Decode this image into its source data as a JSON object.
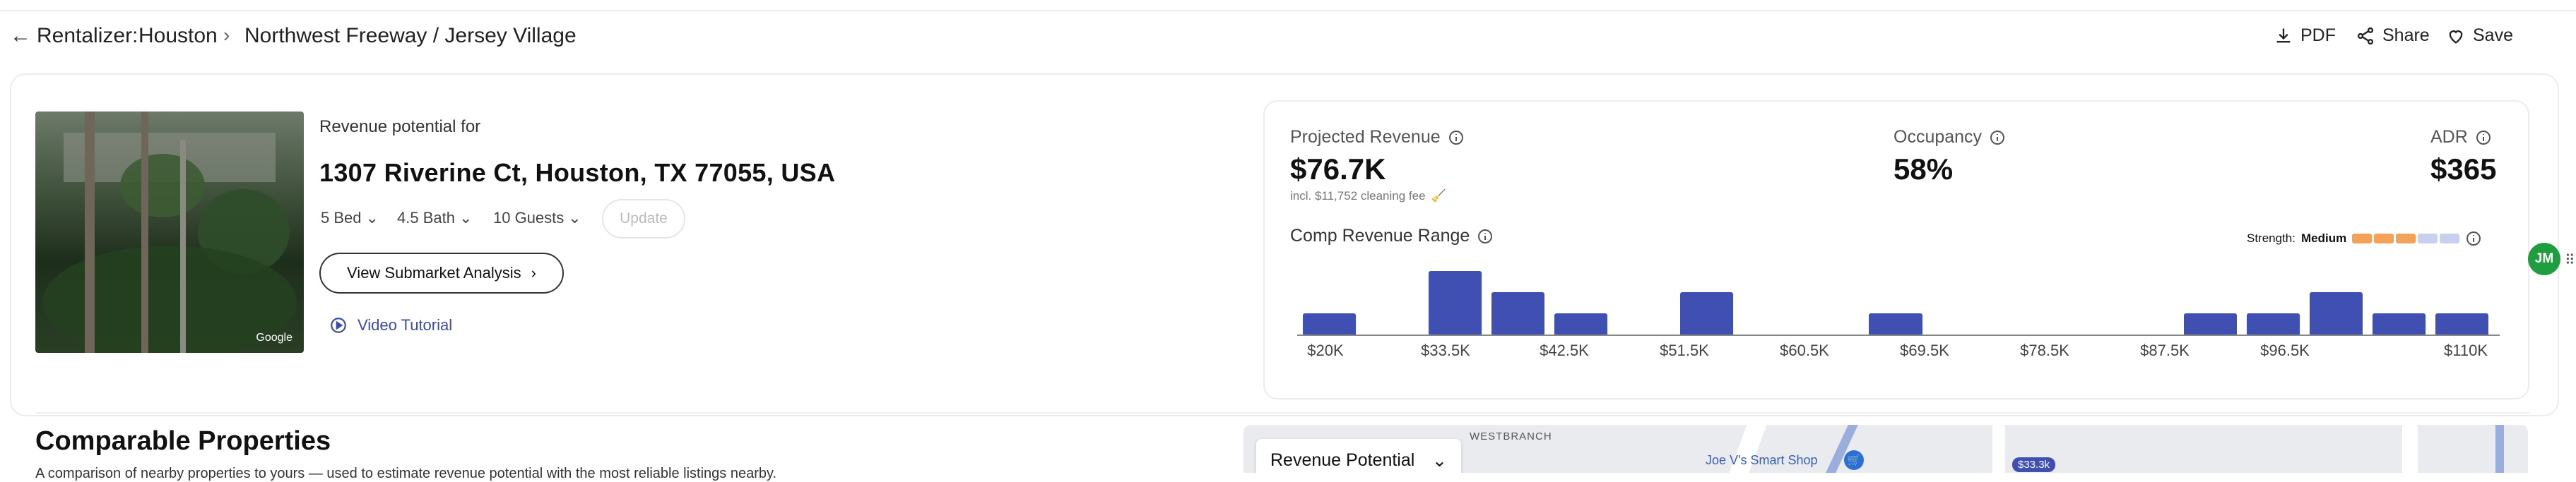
{
  "header": {
    "back_icon": "arrow-left-icon",
    "crumb_root": "Rentalizer:",
    "crumb_city": "Houston",
    "crumb_area": "Northwest Freeway / Jersey Village",
    "actions": {
      "pdf": "PDF",
      "share": "Share",
      "save": "Save"
    }
  },
  "property": {
    "revenue_potential_label": "Revenue potential for",
    "address": "1307 Riverine Ct, Houston, TX 77055, USA",
    "photo_credit": "Google",
    "beds": "5 Bed",
    "baths": "4.5 Bath",
    "guests": "10 Guests",
    "update_label": "Update",
    "submarket_button": "View Submarket Analysis",
    "video_tutorial": "Video Tutorial"
  },
  "metrics": {
    "projected_revenue_label": "Projected Revenue",
    "projected_revenue_value": "$76.7K",
    "cleaning_note": "incl. $11,752 cleaning fee",
    "occupancy_label": "Occupancy",
    "occupancy_value": "58%",
    "adr_label": "ADR",
    "adr_value": "$365",
    "comp_range_label": "Comp Revenue Range",
    "strength_label": "Strength:",
    "strength_value": "Medium",
    "strength_colors": [
      "#f4a259",
      "#f4a259",
      "#f4a259",
      "#c9d0ef",
      "#c9d0ef"
    ]
  },
  "chart_data": {
    "type": "bar",
    "title": "Comp Revenue Range",
    "tick_labels": [
      "$20K",
      "$33.5K",
      "$42.5K",
      "$51.5K",
      "$60.5K",
      "$69.5K",
      "$78.5K",
      "$87.5K",
      "$96.5K",
      "$110K"
    ],
    "bins": [
      20,
      27,
      33.5,
      38,
      42.5,
      47,
      51.5,
      56,
      60.5,
      65,
      69.5,
      74,
      78.5,
      83,
      87.5,
      92,
      96.5,
      101,
      110
    ],
    "values": [
      1,
      0,
      3,
      2,
      1,
      0,
      2,
      0,
      0,
      1,
      0,
      0,
      0,
      0,
      1,
      1,
      2,
      1,
      1
    ],
    "color": "#3f4fb2"
  },
  "comparables": {
    "title": "Comparable Properties",
    "subtitle": "A comparison of nearby properties to yours — used to estimate revenue potential with the most reliable listings nearby."
  },
  "map": {
    "dropdown_label": "Revenue Potential",
    "area_label": "WESTBRANCH",
    "place_label": "Joe V's Smart Shop",
    "price_marker": "$33.3k"
  },
  "avatar": {
    "initials": "JM",
    "color": "#1f9e3f"
  }
}
